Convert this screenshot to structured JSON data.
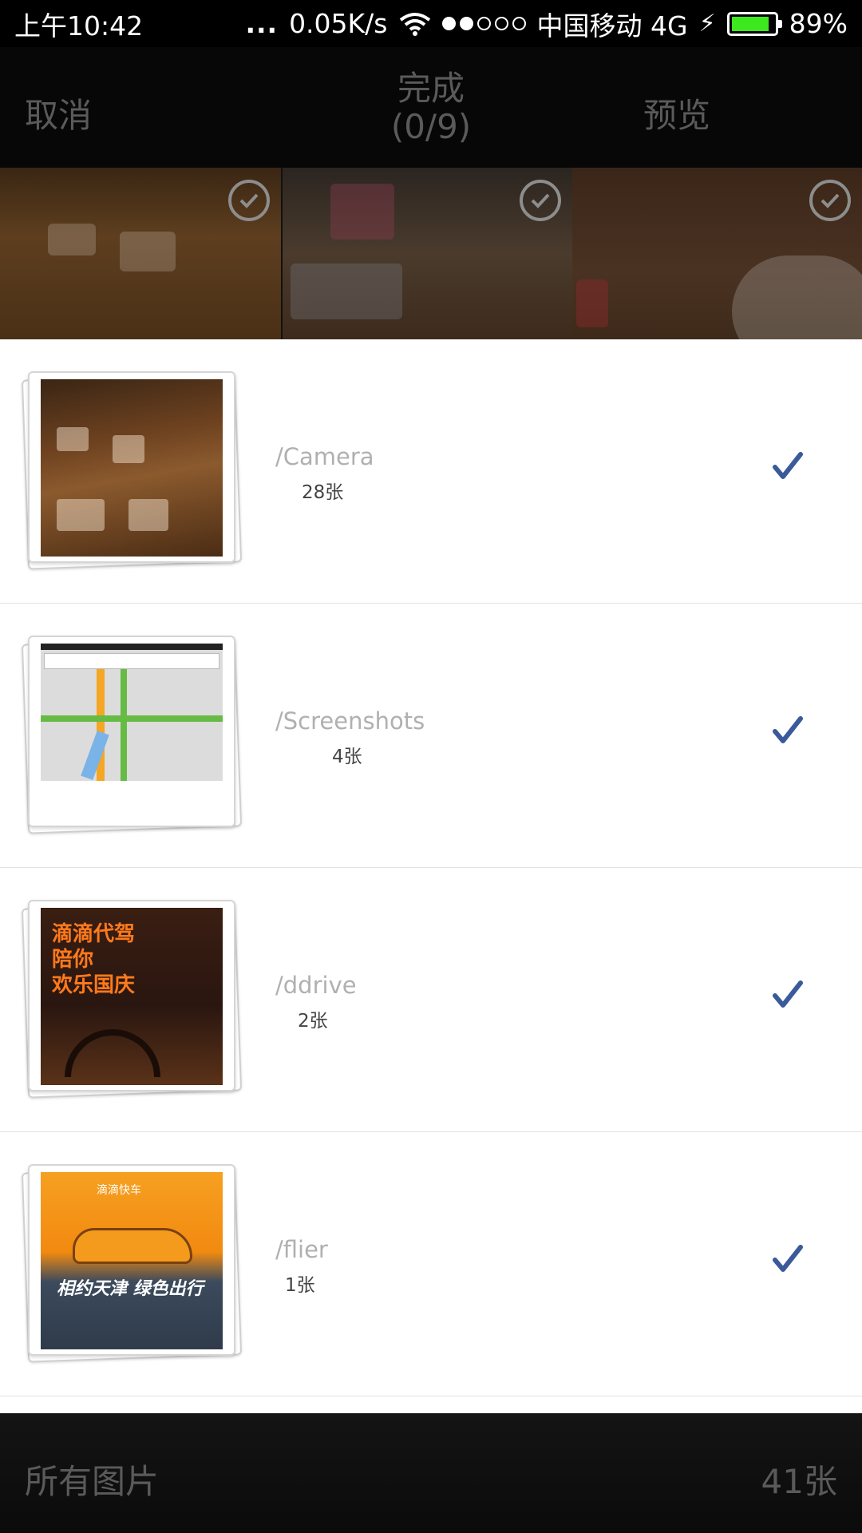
{
  "status_bar": {
    "time": "上午10:42",
    "dots": "...",
    "network_speed": "0.05K/s",
    "carrier": "中国移动 4G",
    "battery": "89%",
    "battery_level": 0.89,
    "signal_strength": 2,
    "battery_color": "#3ee81f"
  },
  "action_bar": {
    "cancel_label": "取消",
    "done_label": "完成",
    "done_count": "(0/9)",
    "preview_label": "预览"
  },
  "folders": [
    {
      "name": "/Camera",
      "count": "28张",
      "selected": true
    },
    {
      "name": "/Screenshots",
      "count": "4张",
      "selected": true
    },
    {
      "name": "/ddrive",
      "count": "2张",
      "selected": true
    },
    {
      "name": "/flier",
      "count": "1张",
      "selected": true
    }
  ],
  "thumbnail_text": {
    "ddrive_line1": "滴滴代驾",
    "ddrive_line2": "陪你",
    "ddrive_line3": "欢乐国庆",
    "flier_brand": "滴滴快车",
    "flier_slogan": "相约天津 绿色出行"
  },
  "bottom_bar": {
    "all_photos_label": "所有图片",
    "total_count": "41张"
  },
  "colors": {
    "check_blue": "#3a5a9a",
    "bar_text": "#5a5a5a"
  }
}
